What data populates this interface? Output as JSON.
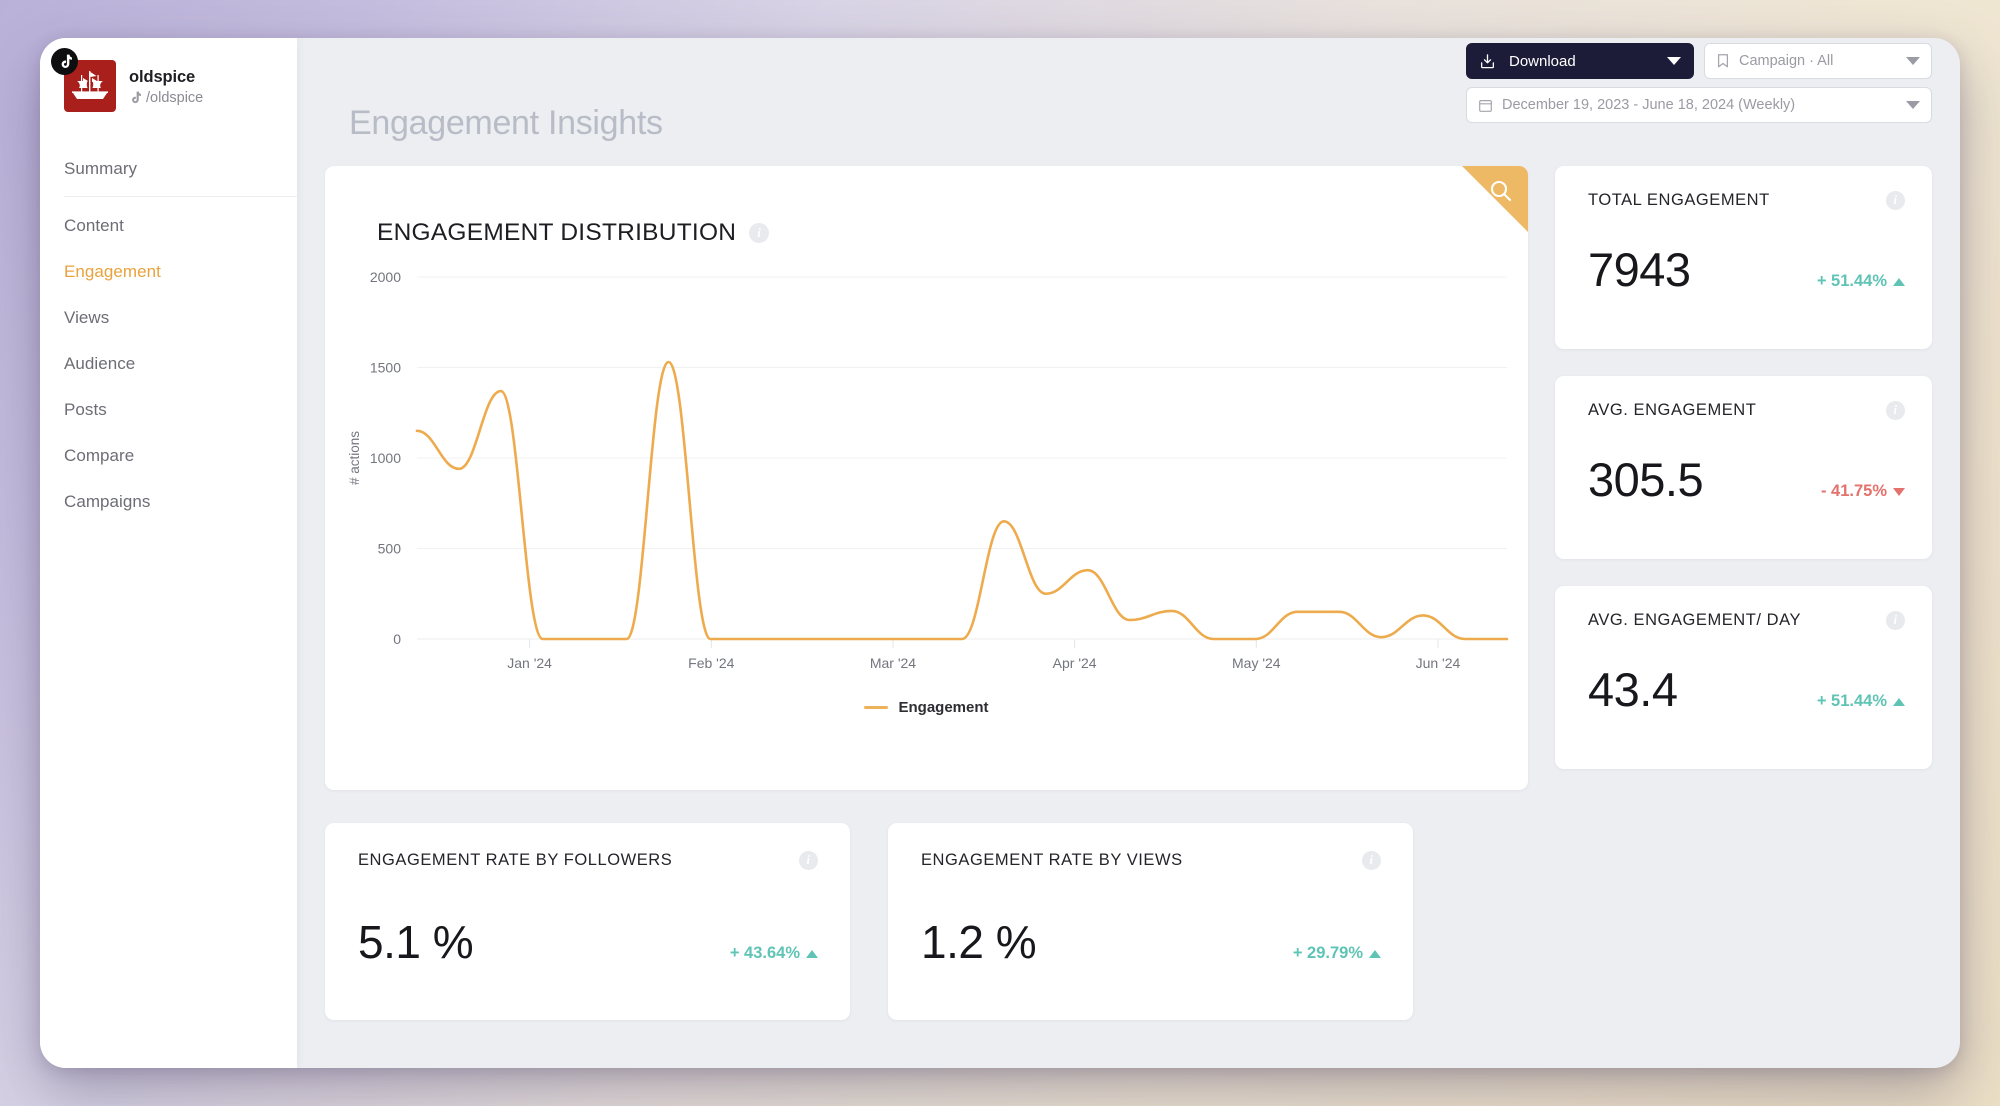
{
  "sidebar": {
    "profile": {
      "name": "oldspice",
      "handle": "/oldspice",
      "avatar_alt": "sailing-ship-logo",
      "platform": "tiktok"
    },
    "items": [
      {
        "label": "Summary",
        "active": false
      },
      {
        "label": "Content",
        "active": false
      },
      {
        "label": "Engagement",
        "active": true
      },
      {
        "label": "Views",
        "active": false
      },
      {
        "label": "Audience",
        "active": false
      },
      {
        "label": "Posts",
        "active": false
      },
      {
        "label": "Compare",
        "active": false
      },
      {
        "label": "Campaigns",
        "active": false
      }
    ]
  },
  "header": {
    "title": "Engagement Insights",
    "download_label": "Download",
    "campaign_label": "Campaign · All",
    "date_range_label": "December 19, 2023 - June 18, 2024 (Weekly)"
  },
  "chart_card": {
    "title": "ENGAGEMENT DISTRIBUTION",
    "info_icon": "i",
    "search_icon": "search-icon"
  },
  "chart_data": {
    "type": "line",
    "title": "ENGAGEMENT DISTRIBUTION",
    "xlabel": "",
    "ylabel": "# actions",
    "ylim": [
      0,
      2000
    ],
    "yticks": [
      0,
      500,
      1000,
      1500,
      2000
    ],
    "xticks": [
      "Jan '24",
      "Feb '24",
      "Mar '24",
      "Apr '24",
      "May '24",
      "Jun '24"
    ],
    "grid": true,
    "legend": {
      "position": "bottom",
      "entries": [
        "Engagement"
      ]
    },
    "color": "#eeab4d",
    "series": [
      {
        "name": "Engagement",
        "x": [
          "2023-12-19",
          "2023-12-26",
          "2024-01-02",
          "2024-01-09",
          "2024-01-16",
          "2024-01-23",
          "2024-01-30",
          "2024-02-06",
          "2024-02-13",
          "2024-02-20",
          "2024-02-27",
          "2024-03-05",
          "2024-03-12",
          "2024-03-19",
          "2024-03-26",
          "2024-04-02",
          "2024-04-09",
          "2024-04-16",
          "2024-04-23",
          "2024-04-30",
          "2024-05-07",
          "2024-05-14",
          "2024-05-21",
          "2024-05-28",
          "2024-06-04",
          "2024-06-11",
          "2024-06-18"
        ],
        "values": [
          1150,
          940,
          1370,
          0,
          0,
          0,
          1530,
          0,
          0,
          0,
          0,
          0,
          0,
          0,
          650,
          250,
          380,
          105,
          155,
          0,
          0,
          150,
          150,
          10,
          130,
          0,
          0
        ]
      }
    ]
  },
  "stats": [
    {
      "label": "TOTAL ENGAGEMENT",
      "value": "7943",
      "delta": "+ 51.44%",
      "direction": "up"
    },
    {
      "label": "AVG. ENGAGEMENT",
      "value": "305.5",
      "delta": "- 41.75%",
      "direction": "down"
    },
    {
      "label": "AVG. ENGAGEMENT/ DAY",
      "value": "43.4",
      "delta": "+ 51.44%",
      "direction": "up"
    }
  ],
  "rate_cards": [
    {
      "label": "ENGAGEMENT RATE BY FOLLOWERS",
      "value": "5.1 %",
      "delta": "+ 43.64%",
      "direction": "up"
    },
    {
      "label": "ENGAGEMENT RATE BY VIEWS",
      "value": "1.2 %",
      "delta": "+ 29.79%",
      "direction": "up"
    }
  ],
  "colors": {
    "accent": "#e8a33d",
    "line": "#eeab4d",
    "positive": "#5fc4b5",
    "negative": "#e4726c",
    "dark": "#1c1b38"
  }
}
